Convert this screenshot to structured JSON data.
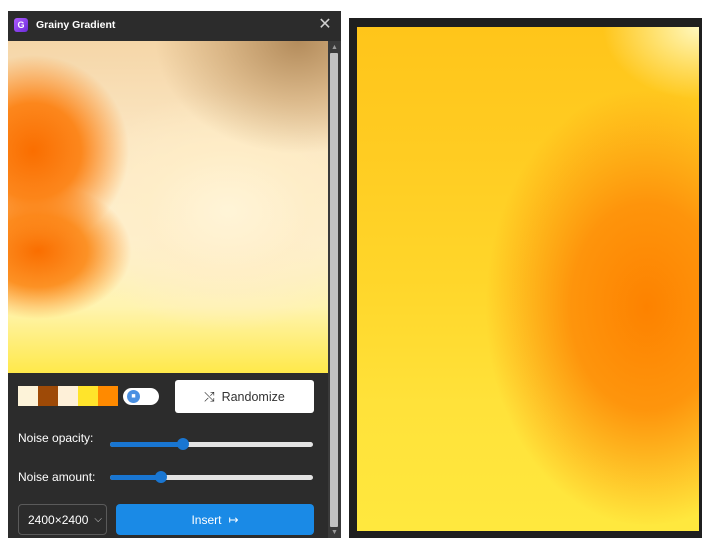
{
  "window": {
    "title": "Grainy Gradient",
    "logo_letter": "G",
    "close_glyph": "✕"
  },
  "colors": {
    "accent": "#1a8ae6",
    "panel_bg": "#2c2c2c"
  },
  "palette": {
    "swatches": [
      "#fdf3d9",
      "#9e4a07",
      "#fef0d8",
      "#ffe42b",
      "#ff8a00"
    ],
    "lock_icon": "lock-icon"
  },
  "actions": {
    "randomize_label": "Randomize",
    "randomize_icon": "shuffle-icon",
    "insert_label": "Insert",
    "insert_icon": "export-icon"
  },
  "sliders": {
    "noise_opacity": {
      "label": "Noise opacity:",
      "value": 0.36
    },
    "noise_amount": {
      "label": "Noise amount:",
      "value": 0.25
    }
  },
  "size": {
    "selected": "2400×2400"
  }
}
